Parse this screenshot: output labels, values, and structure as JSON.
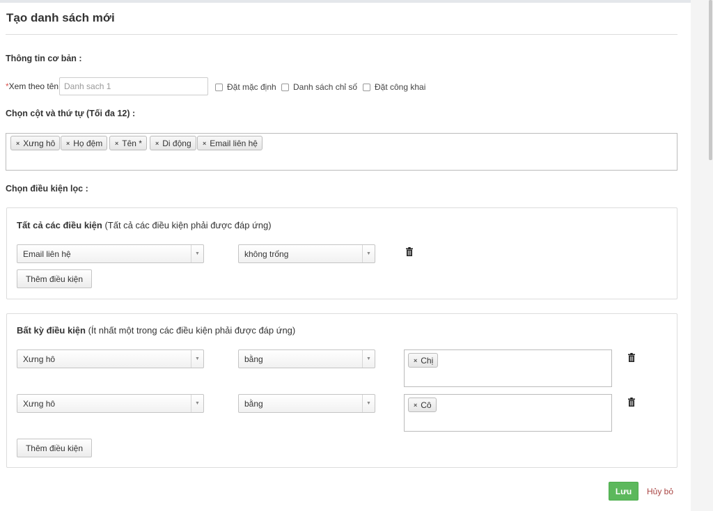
{
  "page": {
    "title": "Tạo danh sách mới"
  },
  "basic": {
    "heading": "Thông tin cơ bản :",
    "required_mark": "*",
    "name_label": "Xem theo tên",
    "name_placeholder": "Danh sach 1",
    "checkboxes": [
      {
        "label": "Đặt mặc định",
        "checked": false
      },
      {
        "label": "Danh sách chỉ số",
        "checked": false
      },
      {
        "label": "Đặt công khai",
        "checked": false
      }
    ]
  },
  "columns": {
    "heading": "Chọn cột và thứ tự (Tối đa 12) :",
    "remove_glyph": "×",
    "tags": [
      "Xưng hô",
      "Họ đệm",
      "Tên *",
      "Di động",
      "Email liên hệ"
    ]
  },
  "filters": {
    "heading": "Chọn điều kiện lọc :",
    "all": {
      "title_bold": "Tất cả các điều kiện",
      "title_rest": " (Tất cả các điều kiện phải được đáp ứng)",
      "conditions": [
        {
          "field": "Email liên hệ",
          "operator": "không trống"
        }
      ],
      "add_label": "Thêm điều kiện"
    },
    "any": {
      "title_bold": "Bất kỳ điều kiện",
      "title_rest": " (Ít nhất một trong các điều kiện phải được đáp ứng)",
      "conditions": [
        {
          "field": "Xưng hô",
          "operator": "bằng",
          "value": "Chị"
        },
        {
          "field": "Xưng hô",
          "operator": "bằng",
          "value": "Cô"
        }
      ],
      "add_label": "Thêm điều kiện"
    }
  },
  "actions": {
    "save_label": "Lưu",
    "cancel_label": "Hủy bỏ"
  },
  "icons": {
    "dropdown": "chevron-down-icon",
    "delete": "trash-icon",
    "remove": "close-icon"
  },
  "colors": {
    "save": "#5cb85c",
    "cancel": "#a94442",
    "required": "#d9534f"
  }
}
